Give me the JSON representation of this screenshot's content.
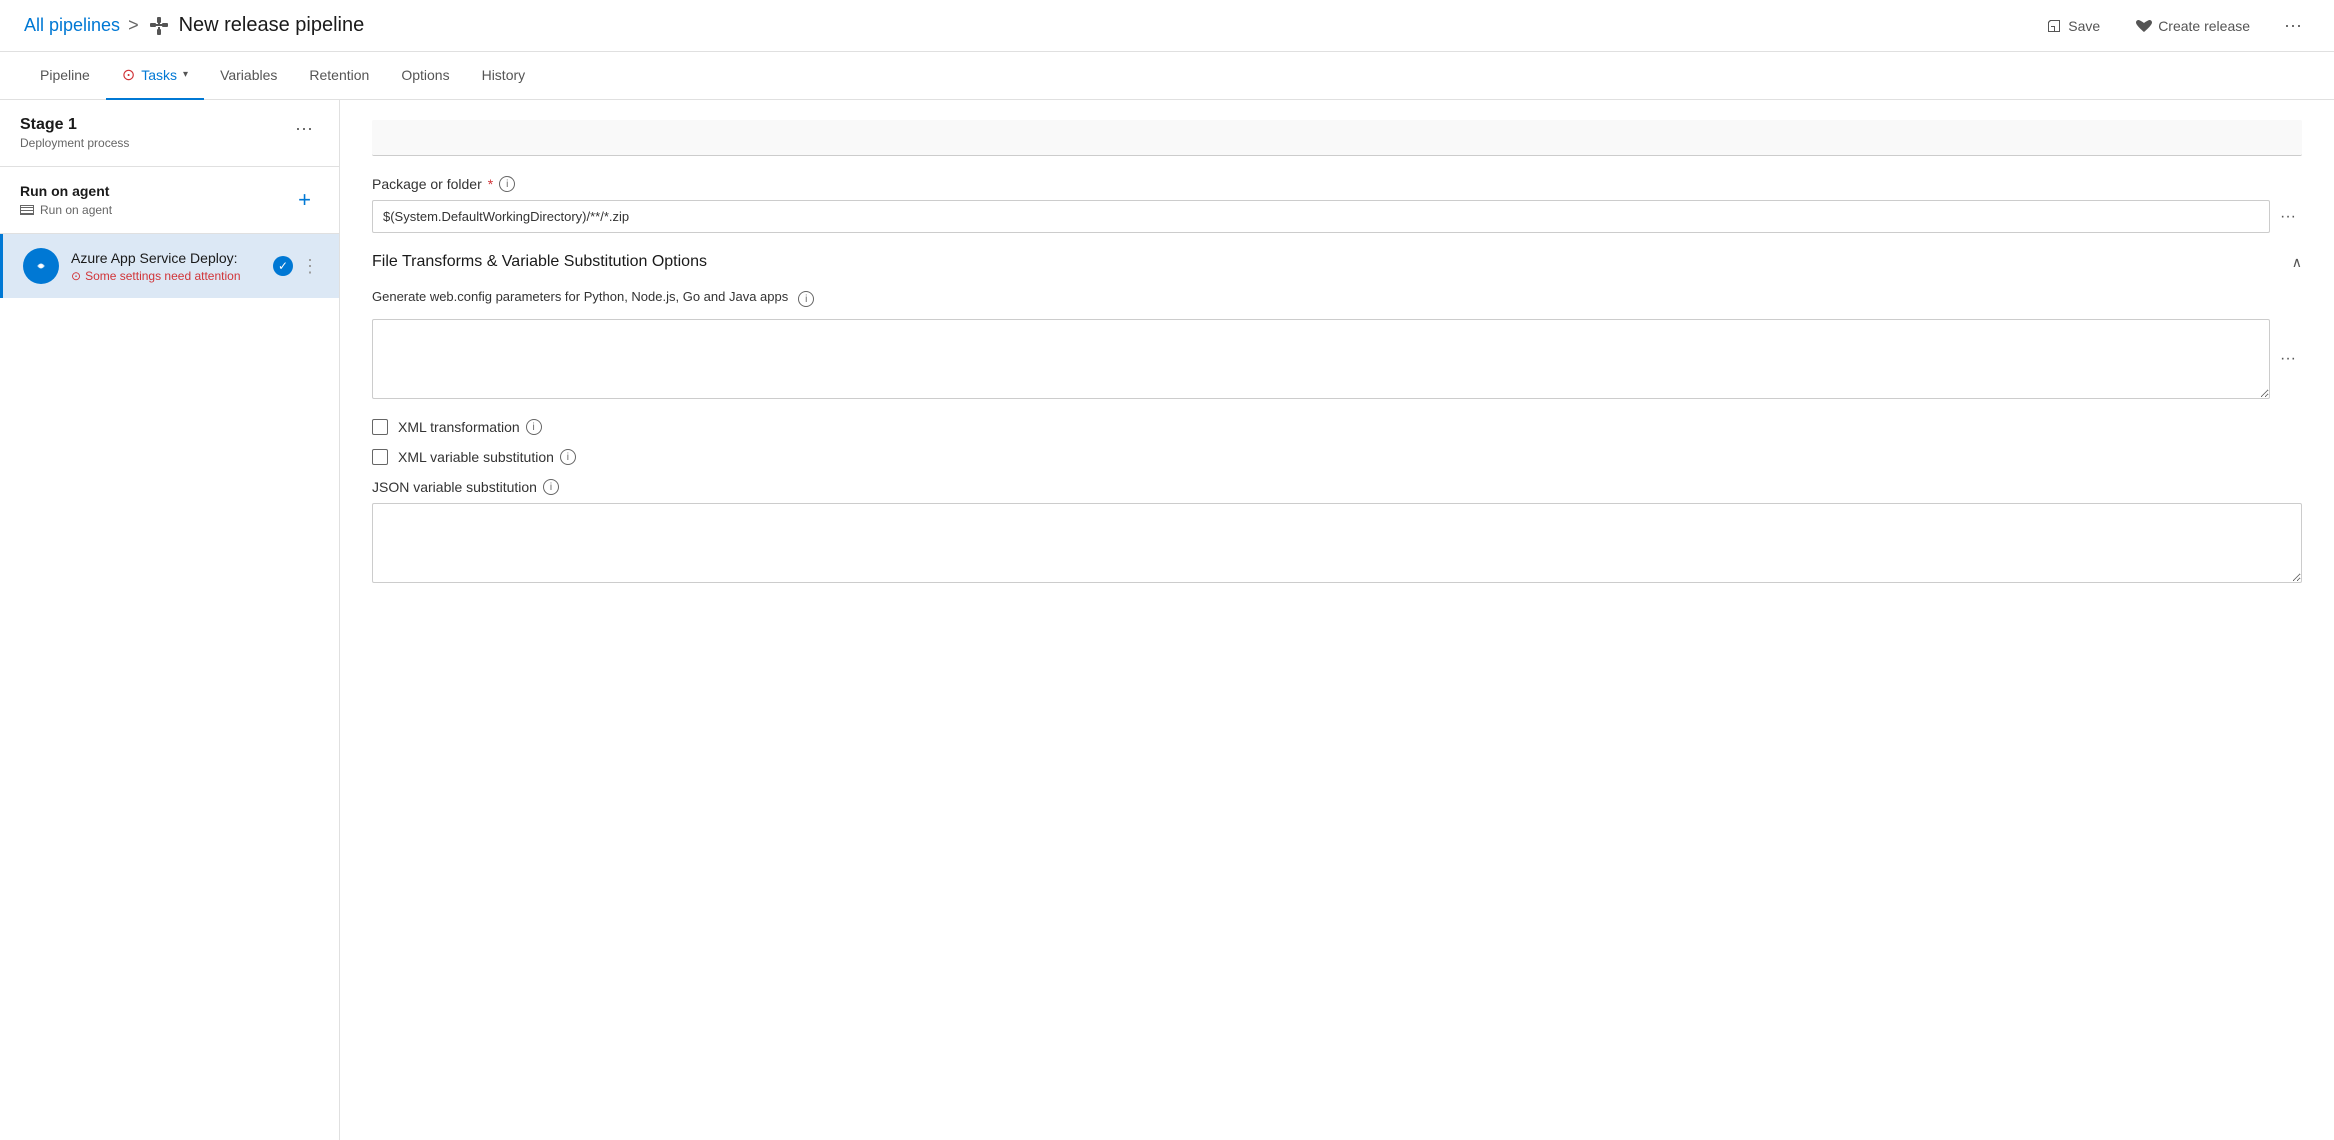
{
  "header": {
    "breadcrumb_link": "All pipelines",
    "separator": ">",
    "title": "New release pipeline",
    "save_label": "Save",
    "create_release_label": "Create release"
  },
  "tabs": [
    {
      "id": "pipeline",
      "label": "Pipeline",
      "active": false
    },
    {
      "id": "tasks",
      "label": "Tasks",
      "active": true,
      "warning": true,
      "has_chevron": true
    },
    {
      "id": "variables",
      "label": "Variables",
      "active": false
    },
    {
      "id": "retention",
      "label": "Retention",
      "active": false
    },
    {
      "id": "options",
      "label": "Options",
      "active": false
    },
    {
      "id": "history",
      "label": "History",
      "active": false
    }
  ],
  "left_panel": {
    "stage_title": "Stage 1",
    "stage_subtitle": "Deployment process",
    "agent": {
      "title": "Run on agent",
      "subtitle": "Run on agent"
    },
    "task": {
      "name": "Azure App Service Deploy:",
      "warning": "Some settings need attention"
    }
  },
  "right_panel": {
    "package_label": "Package or folder",
    "package_required": "*",
    "package_value": "$(System.DefaultWorkingDirectory)/**/*.zip",
    "section_title": "File Transforms & Variable Substitution Options",
    "section_desc": "Generate web.config parameters for Python, Node.js, Go and Java apps",
    "xml_transform_label": "XML transformation",
    "xml_substitution_label": "XML variable substitution",
    "json_substitution_label": "JSON variable substitution"
  }
}
